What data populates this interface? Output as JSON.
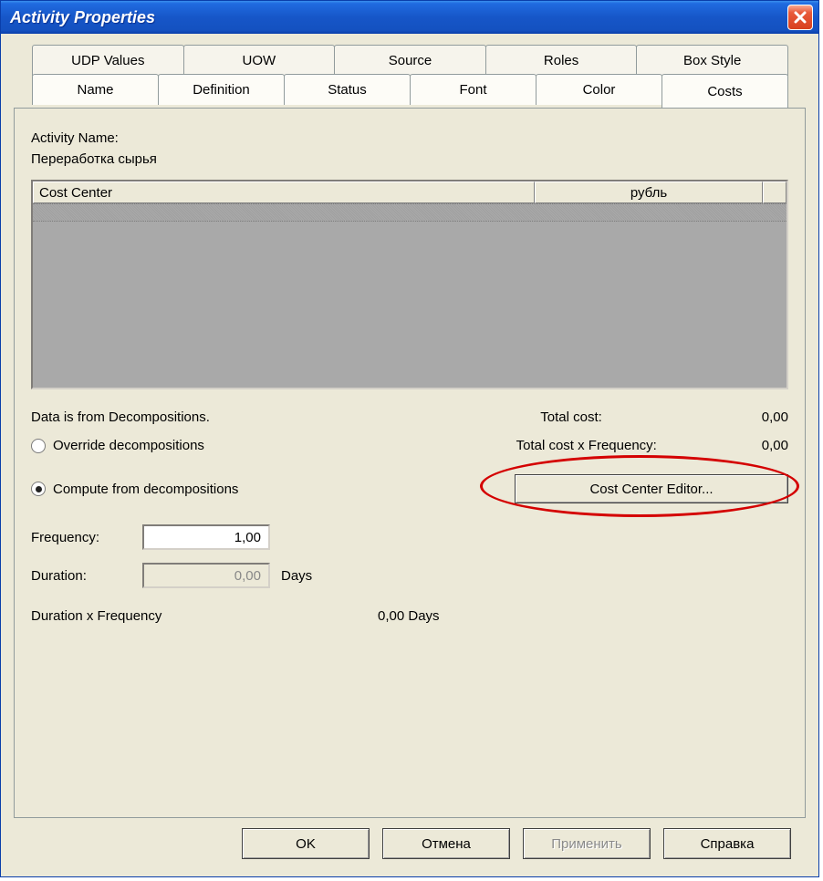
{
  "window": {
    "title": "Activity Properties"
  },
  "tabs": {
    "row1": [
      "UDP Values",
      "UOW",
      "Source",
      "Roles",
      "Box Style"
    ],
    "row2": [
      "Name",
      "Definition",
      "Status",
      "Font",
      "Color",
      "Costs"
    ],
    "active": "Costs"
  },
  "activity": {
    "name_label": "Activity Name:",
    "name_value": "Переработка сырья"
  },
  "grid": {
    "col_cost_center": "Cost Center",
    "col_currency": "рубль"
  },
  "decomp": {
    "note": "Data is from Decompositions.",
    "radio_override": "Override decompositions",
    "radio_compute": "Compute from decompositions",
    "selected": "compute"
  },
  "totals": {
    "total_cost_label": "Total cost:",
    "total_cost_value": "0,00",
    "tcf_label": "Total cost x Frequency:",
    "tcf_value": "0,00"
  },
  "cce_button": "Cost Center Editor...",
  "freq": {
    "label": "Frequency:",
    "value": "1,00"
  },
  "dur": {
    "label": "Duration:",
    "value": "0,00",
    "unit": "Days"
  },
  "dxf": {
    "label": "Duration x Frequency",
    "value": "0,00 Days"
  },
  "buttons": {
    "ok": "OK",
    "cancel": "Отмена",
    "apply": "Применить",
    "help": "Справка"
  }
}
